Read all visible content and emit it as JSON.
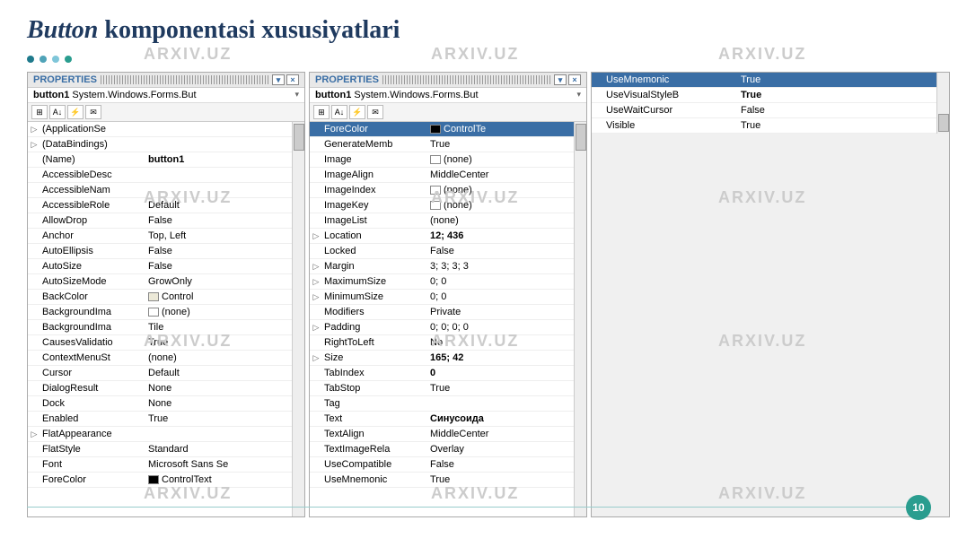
{
  "title": {
    "em": "Button",
    "rest": " komponentasi xususiyatlari"
  },
  "page_number": "10",
  "watermark": "ARXIV.UZ",
  "panel_header_label": "PROPERTIES",
  "object_line": {
    "name": "button1",
    "type": "System.Windows.Forms.But"
  },
  "panel1_rows": [
    {
      "exp": "▷",
      "key": "(ApplicationSe",
      "val": ""
    },
    {
      "exp": "▷",
      "key": "(DataBindings)",
      "val": ""
    },
    {
      "exp": "",
      "key": "(Name)",
      "val": "button1",
      "bold": true
    },
    {
      "exp": "",
      "key": "AccessibleDesc",
      "val": ""
    },
    {
      "exp": "",
      "key": "AccessibleNam",
      "val": ""
    },
    {
      "exp": "",
      "key": "AccessibleRole",
      "val": "Default"
    },
    {
      "exp": "",
      "key": "AllowDrop",
      "val": "False"
    },
    {
      "exp": "",
      "key": "Anchor",
      "val": "Top, Left"
    },
    {
      "exp": "",
      "key": "AutoEllipsis",
      "val": "False"
    },
    {
      "exp": "",
      "key": "AutoSize",
      "val": "False"
    },
    {
      "exp": "",
      "key": "AutoSizeMode",
      "val": "GrowOnly"
    },
    {
      "exp": "",
      "key": "BackColor",
      "val": "Control",
      "swatch": "control"
    },
    {
      "exp": "",
      "key": "BackgroundIma",
      "val": "(none)",
      "swatch": "none"
    },
    {
      "exp": "",
      "key": "BackgroundIma",
      "val": "Tile"
    },
    {
      "exp": "",
      "key": "CausesValidatio",
      "val": "True"
    },
    {
      "exp": "",
      "key": "ContextMenuSt",
      "val": "(none)"
    },
    {
      "exp": "",
      "key": "Cursor",
      "val": "Default"
    },
    {
      "exp": "",
      "key": "DialogResult",
      "val": "None"
    },
    {
      "exp": "",
      "key": "Dock",
      "val": "None"
    },
    {
      "exp": "",
      "key": "Enabled",
      "val": "True"
    },
    {
      "exp": "▷",
      "key": "FlatAppearance",
      "val": ""
    },
    {
      "exp": "",
      "key": "FlatStyle",
      "val": "Standard"
    },
    {
      "exp": "",
      "key": "Font",
      "val": "Microsoft Sans Se"
    },
    {
      "exp": "",
      "key": "ForeColor",
      "val": "ControlText",
      "swatch": "black"
    }
  ],
  "panel2_rows": [
    {
      "exp": "",
      "key": "ForeColor",
      "val": "ControlTe",
      "swatch": "black",
      "selected": true
    },
    {
      "exp": "",
      "key": "GenerateMemb",
      "val": "True"
    },
    {
      "exp": "",
      "key": "Image",
      "val": "(none)",
      "swatch": "none"
    },
    {
      "exp": "",
      "key": "ImageAlign",
      "val": "MiddleCenter"
    },
    {
      "exp": "",
      "key": "ImageIndex",
      "val": "(none)",
      "swatch": "none"
    },
    {
      "exp": "",
      "key": "ImageKey",
      "val": "(none)",
      "swatch": "none"
    },
    {
      "exp": "",
      "key": "ImageList",
      "val": "(none)"
    },
    {
      "exp": "▷",
      "key": "Location",
      "val": "12; 436",
      "bold": true
    },
    {
      "exp": "",
      "key": "Locked",
      "val": "False"
    },
    {
      "exp": "▷",
      "key": "Margin",
      "val": "3; 3; 3; 3"
    },
    {
      "exp": "▷",
      "key": "MaximumSize",
      "val": "0; 0"
    },
    {
      "exp": "▷",
      "key": "MinimumSize",
      "val": "0; 0"
    },
    {
      "exp": "",
      "key": "Modifiers",
      "val": "Private"
    },
    {
      "exp": "▷",
      "key": "Padding",
      "val": "0; 0; 0; 0"
    },
    {
      "exp": "",
      "key": "RightToLeft",
      "val": "No"
    },
    {
      "exp": "▷",
      "key": "Size",
      "val": "165; 42",
      "bold": true
    },
    {
      "exp": "",
      "key": "TabIndex",
      "val": "0",
      "bold": true
    },
    {
      "exp": "",
      "key": "TabStop",
      "val": "True"
    },
    {
      "exp": "",
      "key": "Tag",
      "val": ""
    },
    {
      "exp": "",
      "key": "Text",
      "val": "Синусоида",
      "bold": true
    },
    {
      "exp": "",
      "key": "TextAlign",
      "val": "MiddleCenter"
    },
    {
      "exp": "",
      "key": "TextImageRela",
      "val": "Overlay"
    },
    {
      "exp": "",
      "key": "UseCompatible",
      "val": "False"
    },
    {
      "exp": "",
      "key": "UseMnemonic",
      "val": "True"
    }
  ],
  "panel3_rows": [
    {
      "exp": "",
      "key": "UseMnemonic",
      "val": "True",
      "selected": true,
      "chev": true
    },
    {
      "exp": "",
      "key": "UseVisualStyleB",
      "val": "True",
      "bold": true
    },
    {
      "exp": "",
      "key": "UseWaitCursor",
      "val": "False"
    },
    {
      "exp": "",
      "key": "Visible",
      "val": "True"
    }
  ]
}
